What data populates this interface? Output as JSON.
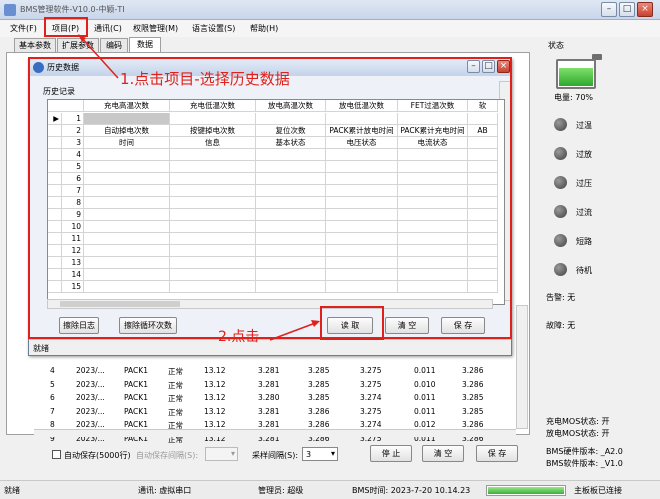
{
  "window": {
    "title": "BMS管理软件-V10.0-中颖-TI"
  },
  "menu": [
    "文件(F)",
    "项目(P)",
    "通讯(C)",
    "权限管理(M)",
    "语言设置(S)",
    "帮助(H)"
  ],
  "tabs": [
    "基本参数",
    "扩展参数",
    "编码",
    "数据"
  ],
  "background_table": {
    "rows": [
      [
        "4",
        "2023/...",
        "PACK1",
        "正常",
        "13.12",
        "3.281",
        "3.285",
        "3.275",
        "0.011",
        "3.286"
      ],
      [
        "5",
        "2023/...",
        "PACK1",
        "正常",
        "13.12",
        "3.281",
        "3.285",
        "3.275",
        "0.010",
        "3.286"
      ],
      [
        "6",
        "2023/...",
        "PACK1",
        "正常",
        "13.12",
        "3.280",
        "3.285",
        "3.274",
        "0.011",
        "3.285"
      ],
      [
        "7",
        "2023/...",
        "PACK1",
        "正常",
        "13.12",
        "3.281",
        "3.286",
        "3.275",
        "0.011",
        "3.285"
      ],
      [
        "8",
        "2023/...",
        "PACK1",
        "正常",
        "13.12",
        "3.281",
        "3.286",
        "3.274",
        "0.012",
        "3.286"
      ],
      [
        "9",
        "2023/...",
        "PACK1",
        "正常",
        "13.12",
        "3.281",
        "3.286",
        "3.275",
        "0.011",
        "3.286"
      ]
    ]
  },
  "bottom_controls": {
    "autosave_label": "自动保存(5000行)",
    "autosave_interval_label": "自动保存间隔(S):",
    "sample_interval_label": "采样间隔(S):",
    "sample_interval_value": "3",
    "stop_button": "停 止",
    "clear_button": "清 空",
    "save_button": "保 存"
  },
  "status_bar": {
    "ready": "就绪",
    "comm": "通讯: 虚拟串口",
    "admin": "管理员: 超级",
    "bms_time": "BMS时间: 2023-7-20 10.14.23",
    "board": "主板板已连接"
  },
  "right_panel": {
    "status_label": "状态",
    "battery_level": 0.7,
    "battery_text": "电量: 70%",
    "indicators": [
      "过温",
      "过放",
      "过压",
      "过流",
      "短路",
      "待机"
    ],
    "alarm": "告警: 无",
    "fault": "故障: 无",
    "charge_mos": "充电MOS状态: 开",
    "discharge_mos": "放电MOS状态: 开",
    "hw_version": "BMS硬件版本: _A2.0",
    "sw_version": "BMS软件版本: _V1.0"
  },
  "dialog": {
    "title": "历史数据",
    "group_label": "历史记录",
    "columns": [
      "充电高温次数",
      "充电低温次数",
      "放电高温次数",
      "放电低温次数",
      "FET过温次数",
      "软"
    ],
    "row2": [
      "自动掉电次数",
      "按键掉电次数",
      "复位次数",
      "PACK累计放电时间",
      "PACK累计充电时间",
      "AB"
    ],
    "row3": [
      "时间",
      "信息",
      "基本状态",
      "电压状态",
      "电流状态",
      ""
    ],
    "row_numbers": [
      "1",
      "2",
      "3",
      "4",
      "5",
      "6",
      "7",
      "8",
      "9",
      "10",
      "11",
      "12",
      "13",
      "14",
      "15"
    ],
    "buttons": {
      "erase_log": "擦除日志",
      "erase_cycles": "擦除循环次数",
      "read": "读 取",
      "clear": "清 空",
      "save": "保 存"
    },
    "status": "就绪"
  },
  "annotations": {
    "step1": "1.点击项目-选择历史数据",
    "step2": "2.点击"
  },
  "colors": {
    "annotation": "#e0201b",
    "battery": "#3fc43f"
  }
}
